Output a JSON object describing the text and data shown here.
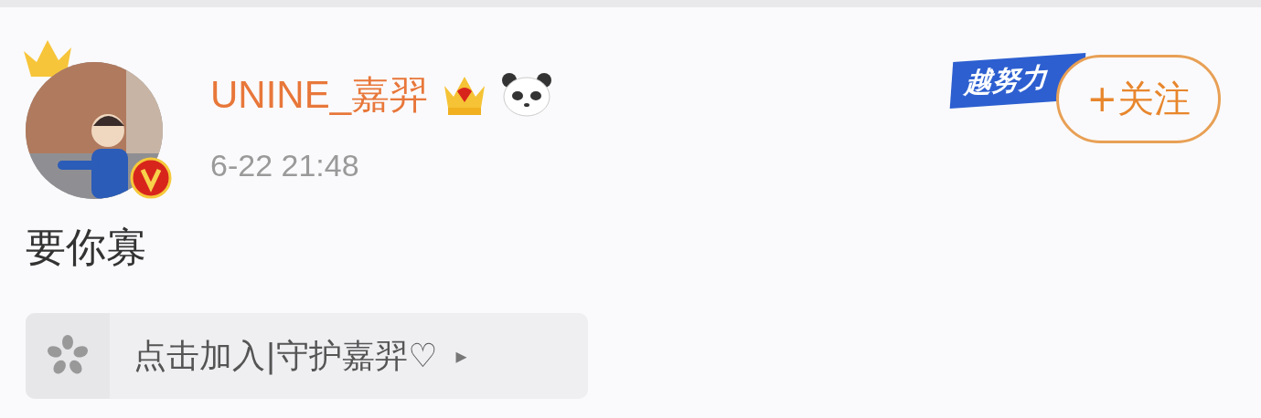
{
  "post": {
    "author": "UNINE_嘉羿",
    "time": "6-22 21:48",
    "text": "要你寡",
    "badge": "越努力",
    "follow_button": "+关注"
  },
  "super_topic": {
    "label": "点击加入|守护嘉羿♡",
    "arrow": "▸"
  }
}
